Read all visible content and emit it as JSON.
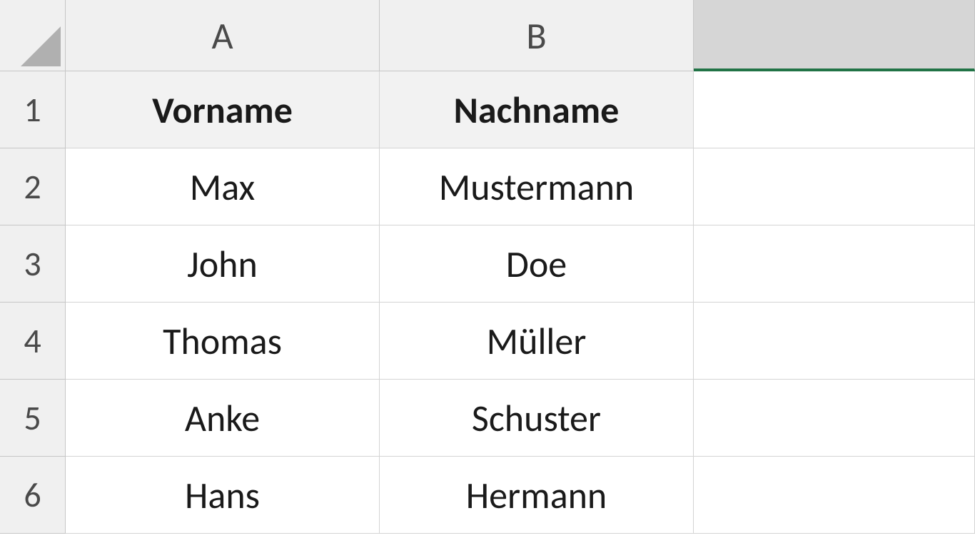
{
  "columns": [
    "A",
    "B"
  ],
  "rows": [
    "1",
    "2",
    "3",
    "4",
    "5",
    "6"
  ],
  "selectedColumnIndex": 2,
  "headers": {
    "vorname": "Vorname",
    "nachname": "Nachname"
  },
  "data": [
    {
      "vorname": "Max",
      "nachname": "Mustermann"
    },
    {
      "vorname": "John",
      "nachname": "Doe"
    },
    {
      "vorname": "Thomas",
      "nachname": "Müller"
    },
    {
      "vorname": "Anke",
      "nachname": "Schuster"
    },
    {
      "vorname": "Hans",
      "nachname": "Hermann"
    }
  ]
}
